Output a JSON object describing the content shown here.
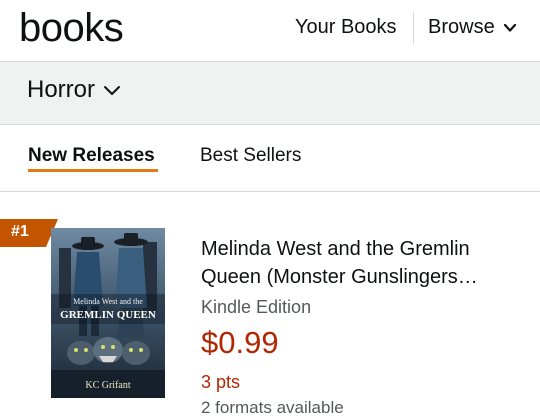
{
  "header": {
    "logo": "books",
    "nav_your_books": "Your Books",
    "nav_browse": "Browse"
  },
  "genre": {
    "label": "Horror"
  },
  "tabs": [
    {
      "label": "New Releases",
      "active": true
    },
    {
      "label": "Best Sellers",
      "active": false
    }
  ],
  "item": {
    "rank": "#1",
    "title_line1": "Melinda West and the Gremlin",
    "title_line2": "Queen (Monster Gunslingers…",
    "format": "Kindle Edition",
    "price": "$0.99",
    "points": "3 pts",
    "formats_available": "2 formats available",
    "cover": {
      "title_top": "Melinda West and the",
      "title_main": "GREMLIN QUEEN",
      "author": "KC Grifant"
    }
  },
  "colors": {
    "accent": "#e47911",
    "price": "#b12704",
    "badge": "#c45500"
  }
}
